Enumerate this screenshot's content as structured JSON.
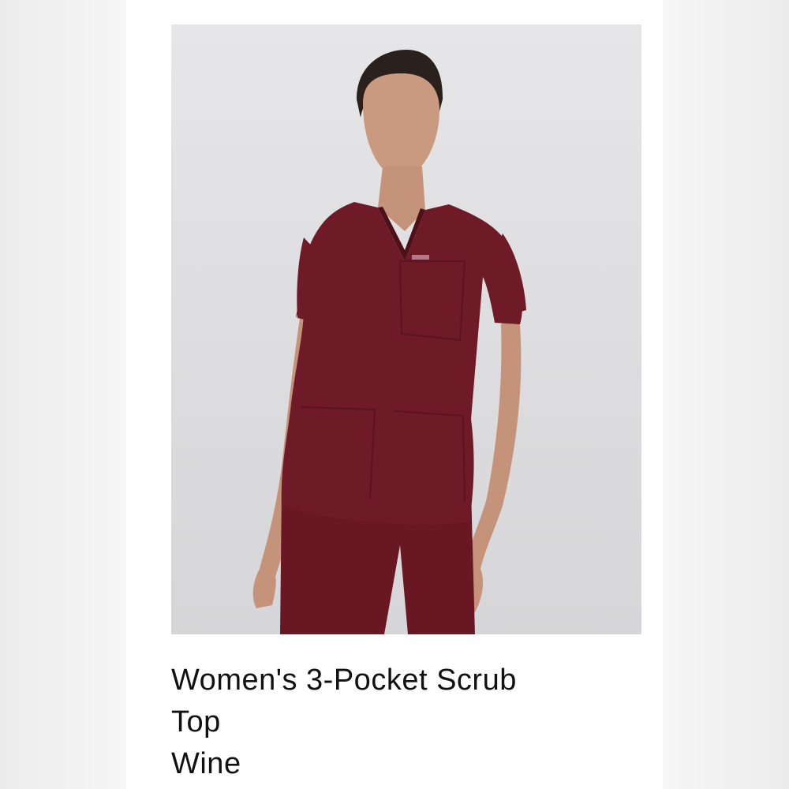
{
  "product": {
    "title_line1": "Women's 3-Pocket Scrub",
    "title_line2": "Top",
    "color_name": "Wine",
    "image_alt": "Model wearing wine-colored scrub top and pants"
  },
  "colors": {
    "garment": "#6e1a27",
    "background": "#dcdcdf",
    "text": "#111111"
  }
}
